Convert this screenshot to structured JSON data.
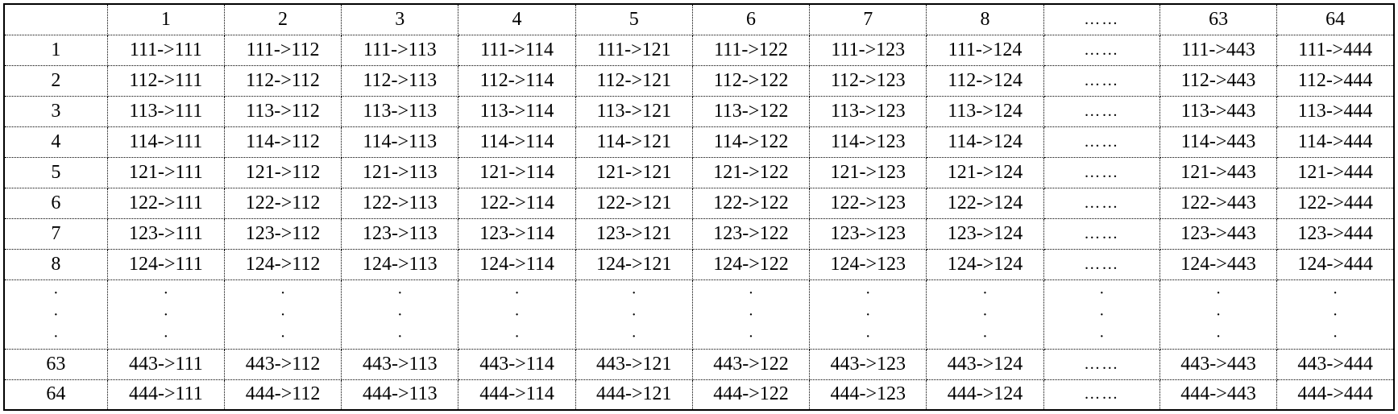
{
  "col_headers": [
    "1",
    "2",
    "3",
    "4",
    "5",
    "6",
    "7",
    "8",
    "……",
    "63",
    "64"
  ],
  "row_headers": [
    "1",
    "2",
    "3",
    "4",
    "5",
    "6",
    "7",
    "8",
    "⋮",
    "63",
    "64"
  ],
  "hdots": "……",
  "vdots": "⋮",
  "chart_data": {
    "type": "table",
    "description": "64x64 transition table; rows 1-8,63,64 and cols 1-8,63,64 shown; row/col prefixes map to codes 111,112,113,114,121,122,123,124,...,443,444",
    "columns": [
      {
        "index": 1,
        "suffix": "111"
      },
      {
        "index": 2,
        "suffix": "112"
      },
      {
        "index": 3,
        "suffix": "113"
      },
      {
        "index": 4,
        "suffix": "114"
      },
      {
        "index": 5,
        "suffix": "121"
      },
      {
        "index": 6,
        "suffix": "122"
      },
      {
        "index": 7,
        "suffix": "123"
      },
      {
        "index": 8,
        "suffix": "124"
      },
      {
        "index": 63,
        "suffix": "443"
      },
      {
        "index": 64,
        "suffix": "444"
      }
    ],
    "rows": [
      {
        "index": 1,
        "prefix": "111",
        "cells": [
          "111->111",
          "111->112",
          "111->113",
          "111->114",
          "111->121",
          "111->122",
          "111->123",
          "111->124",
          "……",
          "111->443",
          "111->444"
        ]
      },
      {
        "index": 2,
        "prefix": "112",
        "cells": [
          "112->111",
          "112->112",
          "112->113",
          "112->114",
          "112->121",
          "112->122",
          "112->123",
          "112->124",
          "……",
          "112->443",
          "112->444"
        ]
      },
      {
        "index": 3,
        "prefix": "113",
        "cells": [
          "113->111",
          "113->112",
          "113->113",
          "113->114",
          "113->121",
          "113->122",
          "113->123",
          "113->124",
          "……",
          "113->443",
          "113->444"
        ]
      },
      {
        "index": 4,
        "prefix": "114",
        "cells": [
          "114->111",
          "114->112",
          "114->113",
          "114->114",
          "114->121",
          "114->122",
          "114->123",
          "114->124",
          "……",
          "114->443",
          "114->444"
        ]
      },
      {
        "index": 5,
        "prefix": "121",
        "cells": [
          "121->111",
          "121->112",
          "121->113",
          "121->114",
          "121->121",
          "121->122",
          "121->123",
          "121->124",
          "……",
          "121->443",
          "121->444"
        ]
      },
      {
        "index": 6,
        "prefix": "122",
        "cells": [
          "122->111",
          "122->112",
          "122->113",
          "122->114",
          "122->121",
          "122->122",
          "122->123",
          "122->124",
          "……",
          "122->443",
          "122->444"
        ]
      },
      {
        "index": 7,
        "prefix": "123",
        "cells": [
          "123->111",
          "123->112",
          "123->113",
          "123->114",
          "123->121",
          "123->122",
          "123->123",
          "123->124",
          "……",
          "123->443",
          "123->444"
        ]
      },
      {
        "index": 8,
        "prefix": "124",
        "cells": [
          "124->111",
          "124->112",
          "124->113",
          "124->114",
          "124->121",
          "124->122",
          "124->123",
          "124->124",
          "……",
          "124->443",
          "124->444"
        ]
      },
      {
        "index": 63,
        "prefix": "443",
        "cells": [
          "443->111",
          "443->112",
          "443->113",
          "443->114",
          "443->121",
          "443->122",
          "443->123",
          "443->124",
          "……",
          "443->443",
          "443->444"
        ]
      },
      {
        "index": 64,
        "prefix": "444",
        "cells": [
          "444->111",
          "444->112",
          "444->113",
          "444->114",
          "444->121",
          "444->122",
          "444->123",
          "444->124",
          "……",
          "444->443",
          "444->444"
        ]
      }
    ]
  }
}
